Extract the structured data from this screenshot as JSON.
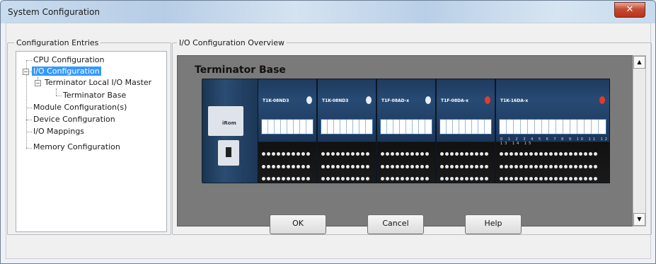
{
  "window": {
    "title": "System Configuration",
    "close_glyph": "✕"
  },
  "tree": {
    "group_label": "Configuration Entries",
    "items": [
      {
        "label": "CPU Configuration"
      },
      {
        "label": "I/O Configuration",
        "selected": true,
        "expander": "−"
      },
      {
        "label": "Terminator Local I/O Master",
        "expander": "−"
      },
      {
        "label": "Terminator Base"
      },
      {
        "label": "Module Configuration(s)"
      },
      {
        "label": "Device Configuration"
      },
      {
        "label": "I/O Mappings"
      },
      {
        "label": "Memory Configuration"
      }
    ]
  },
  "overview": {
    "group_label": "I/O Configuration Overview",
    "base_title": "Terminator Base",
    "cpu": {
      "brand": "iRom"
    },
    "modules": [
      {
        "name": "T1K-08ND3",
        "oval_color": "#ffffff"
      },
      {
        "name": "T1K-08ND3",
        "oval_color": "#ffffff"
      },
      {
        "name": "T1F-08AD-x",
        "oval_color": "#ffffff"
      },
      {
        "name": "T1F-08DA-x",
        "oval_color": "#e23b2b"
      },
      {
        "name": "T1K-16DA-x",
        "oval_color": "#e23b2b",
        "numbers": "0 1 2 3 4 5 6 7 8 9 10 11 12 13 14 15"
      }
    ]
  },
  "scrollbar": {
    "up": "▲",
    "down": "▼"
  },
  "buttons": {
    "ok": "OK",
    "cancel": "Cancel",
    "help": "Help"
  }
}
